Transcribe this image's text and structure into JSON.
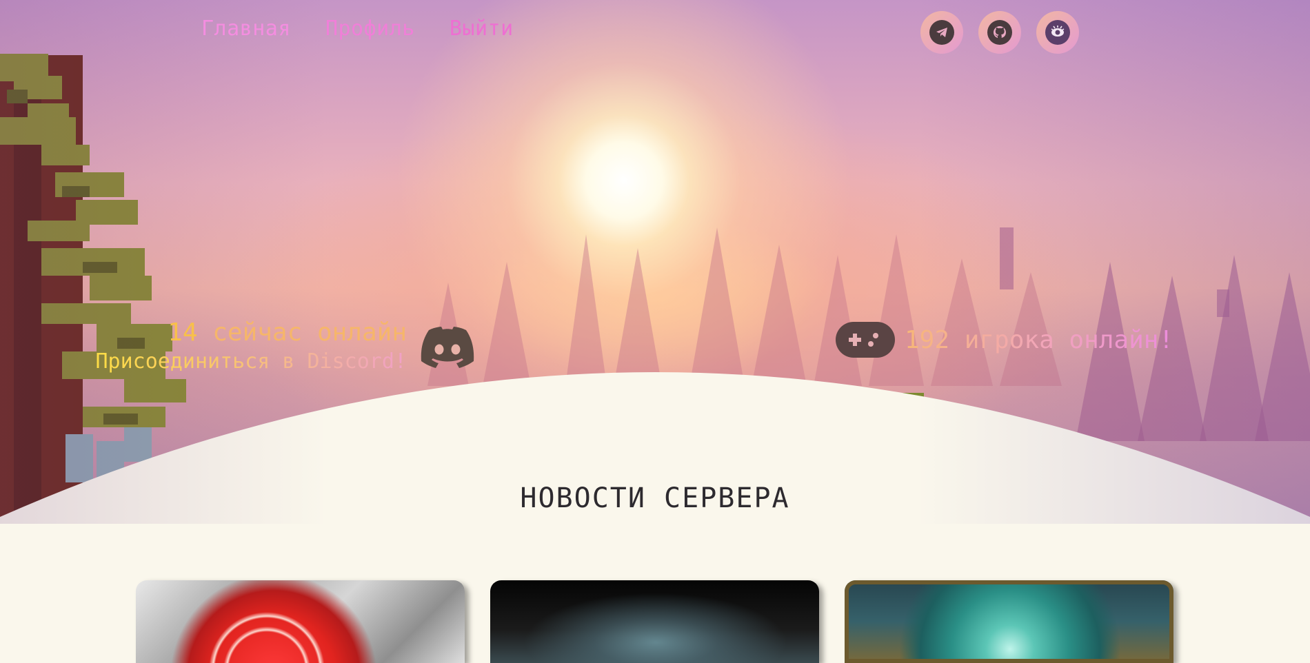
{
  "nav": {
    "links": [
      "Главная",
      "Профиль",
      "Выйти"
    ]
  },
  "socials": [
    {
      "icon": "telegram-icon"
    },
    {
      "icon": "github-icon"
    },
    {
      "icon": "eye-logo-icon"
    }
  ],
  "discord": {
    "online_count": "14",
    "online_text": " сейчас онлайн",
    "join_label": "Присоединиться в Discord!",
    "icon": "discord-icon"
  },
  "players": {
    "text": "192 игрока онлайн!",
    "icon": "gamepad-icon"
  },
  "news": {
    "title": "НОВОСТИ СЕРВЕРА",
    "cards": [
      {
        "name": "news-card-1"
      },
      {
        "name": "news-card-2"
      },
      {
        "name": "news-card-3"
      }
    ]
  },
  "colors": {
    "page_bg": "#faf7ec",
    "nav_pink": "#f07fd8",
    "discord_yellow": "#ffe23d",
    "dark_text": "#2d2a2f",
    "icon_dark": "#4a3b3e"
  }
}
